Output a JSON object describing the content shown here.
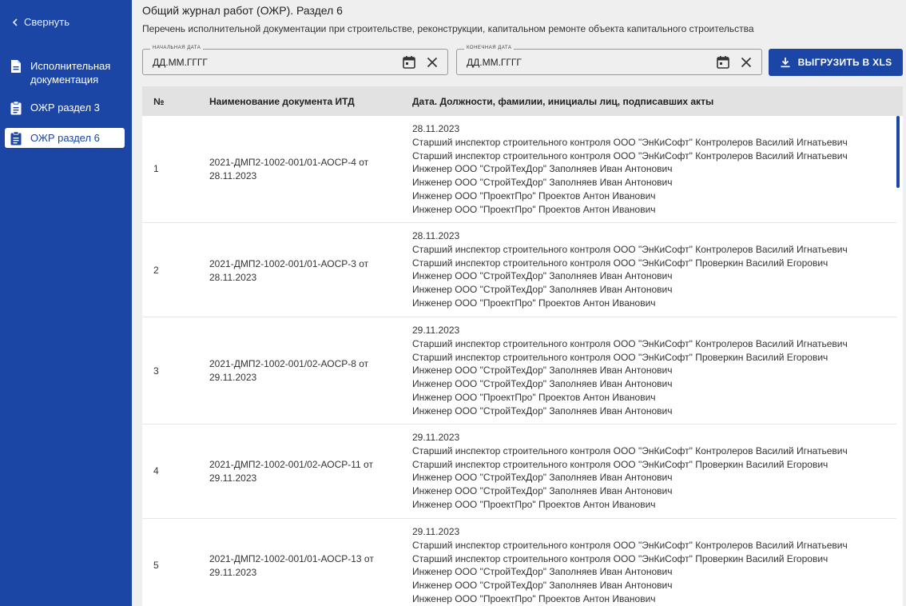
{
  "sidebar": {
    "collapse_label": "Свернуть",
    "items": [
      {
        "label": "Исполнительная документация",
        "icon": "document-icon"
      },
      {
        "label": "ОЖР раздел 3",
        "icon": "clipboard-icon"
      },
      {
        "label": "ОЖР раздел 6",
        "icon": "clipboard-icon",
        "active": true
      }
    ]
  },
  "header": {
    "title": "Общий журнал работ (ОЖР). Раздел 6",
    "subtitle": "Перечень исполнительной документации при строительстве, реконструкции, капитальном ремонте объекта капитального строительства"
  },
  "filters": {
    "start": {
      "legend": "Начальная дата",
      "placeholder": "ДД.ММ.ГГГГ"
    },
    "end": {
      "legend": "Конечная дата",
      "placeholder": "ДД.ММ.ГГГГ"
    },
    "export_label": "ВЫГРУЗИТЬ В XLS"
  },
  "table": {
    "columns": [
      "№",
      "Наименование документа ИТД",
      "Дата. Должности, фамилии, инициалы лиц, подписавших акты"
    ],
    "rows": [
      {
        "num": "1",
        "doc": "2021-ДМП2-1002-001/01-АОСР-4 от 28.11.2023",
        "lines": [
          "28.11.2023",
          "Старший инспектор строительного контроля ООО \"ЭнКиСофт\" Контролеров Василий Игнатьевич",
          "Старший инспектор строительного контроля ООО \"ЭнКиСофт\" Контролеров Василий Игнатьевич",
          "Инженер ООО \"СтройТехДор\" Заполняев Иван Антонович",
          "Инженер ООО \"СтройТехДор\" Заполняев Иван Антонович",
          "Инженер ООО \"ПроектПро\" Проектов Антон Иванович",
          "Инженер ООО \"ПроектПро\" Проектов Антон Иванович"
        ]
      },
      {
        "num": "2",
        "doc": "2021-ДМП2-1002-001/01-АОСР-3 от 28.11.2023",
        "lines": [
          "28.11.2023",
          "Старший инспектор строительного контроля ООО \"ЭнКиСофт\" Контролеров Василий Игнатьевич",
          "Старший инспектор строительного контроля ООО \"ЭнКиСофт\" Проверкин Василий Егорович",
          "Инженер ООО \"СтройТехДор\" Заполняев Иван Антонович",
          "Инженер ООО \"СтройТехДор\" Заполняев Иван Антонович",
          "Инженер ООО \"ПроектПро\" Проектов Антон Иванович"
        ]
      },
      {
        "num": "3",
        "doc": "2021-ДМП2-1002-001/02-АОСР-8 от 29.11.2023",
        "lines": [
          "29.11.2023",
          "Старший инспектор строительного контроля ООО \"ЭнКиСофт\" Контролеров Василий Игнатьевич",
          "Старший инспектор строительного контроля ООО \"ЭнКиСофт\" Проверкин Василий Егорович",
          "Инженер ООО \"СтройТехДор\" Заполняев Иван Антонович",
          "Инженер ООО \"СтройТехДор\" Заполняев Иван Антонович",
          "Инженер ООО \"ПроектПро\" Проектов Антон Иванович",
          "Инженер ООО \"СтройТехДор\" Заполняев Иван Антонович"
        ]
      },
      {
        "num": "4",
        "doc": "2021-ДМП2-1002-001/02-АОСР-11 от 29.11.2023",
        "lines": [
          "29.11.2023",
          "Старший инспектор строительного контроля ООО \"ЭнКиСофт\" Контролеров Василий Игнатьевич",
          "Старший инспектор строительного контроля ООО \"ЭнКиСофт\" Проверкин Василий Егорович",
          "Инженер ООО \"СтройТехДор\" Заполняев Иван Антонович",
          "Инженер ООО \"СтройТехДор\" Заполняев Иван Антонович",
          "Инженер ООО \"ПроектПро\" Проектов Антон Иванович"
        ]
      },
      {
        "num": "5",
        "doc": "2021-ДМП2-1002-001/01-АОСР-13 от 29.11.2023",
        "lines": [
          "29.11.2023",
          "Старший инспектор строительного контроля ООО \"ЭнКиСофт\" Контролеров Василий Игнатьевич",
          "Старший инспектор строительного контроля ООО \"ЭнКиСофт\" Проверкин Василий Егорович",
          "Инженер ООО \"СтройТехДор\" Заполняев Иван Антонович",
          "Инженер ООО \"СтройТехДор\" Заполняев Иван Антонович",
          "Инженер ООО \"ПроектПро\" Проектов Антон Иванович"
        ]
      }
    ]
  },
  "colors": {
    "primary": "#1b46a5",
    "background": "#efefef",
    "table_header": "#e2e2e2"
  }
}
